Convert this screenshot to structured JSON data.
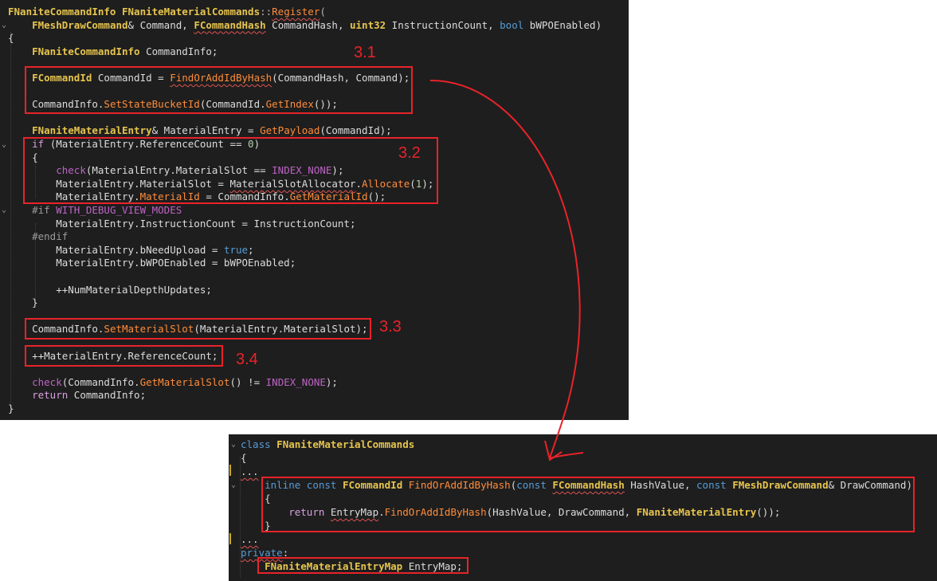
{
  "colors": {
    "annotation": "#e8232a",
    "background": "#1e1e1e"
  },
  "top_code": [
    [
      [
        "FNaniteCommandInfo",
        "type"
      ],
      [
        " ",
        "var"
      ],
      [
        "FNaniteMaterialCommands",
        "type"
      ],
      [
        "::",
        "pun"
      ],
      [
        "Register",
        "fnm",
        "sq"
      ],
      [
        "(",
        "pun"
      ]
    ],
    [
      [
        "    ",
        "var"
      ],
      [
        "FMeshDrawCommand",
        "type"
      ],
      [
        "& Command, ",
        "var"
      ],
      [
        "FCommandHash",
        "type",
        "sq"
      ],
      [
        " CommandHash, ",
        "var"
      ],
      [
        "uint32",
        "type"
      ],
      [
        " InstructionCount, ",
        "var"
      ],
      [
        "bool",
        "kw"
      ],
      [
        " bWPOEnabled)",
        "var"
      ]
    ],
    [
      [
        "{",
        "var"
      ]
    ],
    [
      [
        "    ",
        "var"
      ],
      [
        "FNaniteCommandInfo",
        "type"
      ],
      [
        " CommandInfo;",
        "var"
      ]
    ],
    [
      [
        "",
        "var"
      ]
    ],
    [
      [
        "    ",
        "var"
      ],
      [
        "FCommandId",
        "type"
      ],
      [
        " CommandId = ",
        "var"
      ],
      [
        "FindOrAddIdByHash",
        "fnm",
        "sq"
      ],
      [
        "(CommandHash, Command);",
        "var"
      ]
    ],
    [
      [
        "",
        "var"
      ]
    ],
    [
      [
        "    CommandInfo.",
        "var"
      ],
      [
        "SetStateBucketId",
        "fnm"
      ],
      [
        "(CommandId.",
        "var"
      ],
      [
        "GetIndex",
        "fnm"
      ],
      [
        "());",
        "var"
      ]
    ],
    [
      [
        "",
        "var"
      ]
    ],
    [
      [
        "    ",
        "var"
      ],
      [
        "FNaniteMaterialEntry",
        "type"
      ],
      [
        "& MaterialEntry = ",
        "var"
      ],
      [
        "GetPayload",
        "fnm"
      ],
      [
        "(CommandId);",
        "var"
      ]
    ],
    [
      [
        "    ",
        "var"
      ],
      [
        "if",
        "ctl"
      ],
      [
        " (MaterialEntry.ReferenceCount == ",
        "var"
      ],
      [
        "0",
        "num"
      ],
      [
        ")",
        "var"
      ]
    ],
    [
      [
        "    {",
        "var"
      ]
    ],
    [
      [
        "        ",
        "var"
      ],
      [
        "check",
        "macro"
      ],
      [
        "(MaterialEntry.MaterialSlot == ",
        "var"
      ],
      [
        "INDEX_NONE",
        "macro"
      ],
      [
        ");",
        "var"
      ]
    ],
    [
      [
        "        MaterialEntry.MaterialSlot = ",
        "var"
      ],
      [
        "MaterialSlotAllocator",
        "var",
        "sq"
      ],
      [
        ".",
        "var"
      ],
      [
        "Allocate",
        "fnm"
      ],
      [
        "(",
        "var"
      ],
      [
        "1",
        "num"
      ],
      [
        ");",
        "var"
      ]
    ],
    [
      [
        "        MaterialEntry.",
        "var"
      ],
      [
        "MaterialId",
        "fnm"
      ],
      [
        " = CommandInfo.",
        "var"
      ],
      [
        "GetMaterialId",
        "fnm"
      ],
      [
        "();",
        "var"
      ]
    ],
    [
      [
        "    ",
        "var"
      ],
      [
        "#if",
        "pp"
      ],
      [
        " ",
        "var"
      ],
      [
        "WITH_DEBUG_VIEW_MODES",
        "macro"
      ]
    ],
    [
      [
        "        MaterialEntry.InstructionCount = InstructionCount;",
        "var"
      ]
    ],
    [
      [
        "    ",
        "var"
      ],
      [
        "#endif",
        "pp"
      ]
    ],
    [
      [
        "        MaterialEntry.bNeedUpload = ",
        "var"
      ],
      [
        "true",
        "kw"
      ],
      [
        ";",
        "var"
      ]
    ],
    [
      [
        "        MaterialEntry.bWPOEnabled = bWPOEnabled;",
        "var"
      ]
    ],
    [
      [
        "",
        "var"
      ]
    ],
    [
      [
        "        ++NumMaterialDepthUpdates;",
        "var"
      ]
    ],
    [
      [
        "    }",
        "var"
      ]
    ],
    [
      [
        "",
        "var"
      ]
    ],
    [
      [
        "    CommandInfo.",
        "var"
      ],
      [
        "SetMaterialSlot",
        "fnm"
      ],
      [
        "(MaterialEntry.MaterialSlot);",
        "var"
      ]
    ],
    [
      [
        "",
        "var"
      ]
    ],
    [
      [
        "    ++MaterialEntry.ReferenceCount;",
        "var"
      ]
    ],
    [
      [
        "",
        "var"
      ]
    ],
    [
      [
        "    ",
        "var"
      ],
      [
        "check",
        "macro"
      ],
      [
        "(CommandInfo.",
        "var"
      ],
      [
        "GetMaterialSlot",
        "fnm"
      ],
      [
        "() != ",
        "var"
      ],
      [
        "INDEX_NONE",
        "macro"
      ],
      [
        ");",
        "var"
      ]
    ],
    [
      [
        "    ",
        "var"
      ],
      [
        "return",
        "ctl"
      ],
      [
        " CommandInfo;",
        "var"
      ]
    ],
    [
      [
        "}",
        "var"
      ]
    ]
  ],
  "bottom_code": [
    [
      [
        "class",
        "kw"
      ],
      [
        " ",
        "var"
      ],
      [
        "FNaniteMaterialCommands",
        "type"
      ]
    ],
    [
      [
        "{",
        "var"
      ]
    ],
    [
      [
        "...",
        "var",
        "sq"
      ]
    ],
    [
      [
        "    ",
        "var"
      ],
      [
        "inline",
        "kw"
      ],
      [
        " ",
        "var"
      ],
      [
        "const",
        "kw"
      ],
      [
        " ",
        "var"
      ],
      [
        "FCommandId",
        "type"
      ],
      [
        " ",
        "var"
      ],
      [
        "FindOrAddIdByHash",
        "fnm"
      ],
      [
        "(",
        "var"
      ],
      [
        "const",
        "kw"
      ],
      [
        " ",
        "var"
      ],
      [
        "FCommandHash",
        "type",
        "sq"
      ],
      [
        " HashValue, ",
        "var"
      ],
      [
        "const",
        "kw"
      ],
      [
        " ",
        "var"
      ],
      [
        "FMeshDrawCommand",
        "type"
      ],
      [
        "& DrawCommand)",
        "var"
      ]
    ],
    [
      [
        "    {",
        "var"
      ]
    ],
    [
      [
        "        ",
        "var"
      ],
      [
        "return",
        "ctl"
      ],
      [
        " ",
        "var"
      ],
      [
        "EntryMap",
        "var",
        "sq"
      ],
      [
        ".",
        "var"
      ],
      [
        "FindOrAddIdByHash",
        "fnm"
      ],
      [
        "(HashValue, DrawCommand, ",
        "var"
      ],
      [
        "FNaniteMaterialEntry",
        "type"
      ],
      [
        "());",
        "var"
      ]
    ],
    [
      [
        "    }",
        "var"
      ]
    ],
    [
      [
        "...",
        "var",
        "sq"
      ]
    ],
    [
      [
        "private",
        "kw",
        "sq"
      ],
      [
        ":",
        "var"
      ]
    ],
    [
      [
        "    ",
        "var"
      ],
      [
        "FNaniteMaterialEntryMap",
        "type"
      ],
      [
        " EntryMap;",
        "var"
      ]
    ]
  ],
  "annotations": [
    "3.1",
    "3.2",
    "3.3",
    "3.4"
  ],
  "fold_icon": "chevron-down-icon"
}
